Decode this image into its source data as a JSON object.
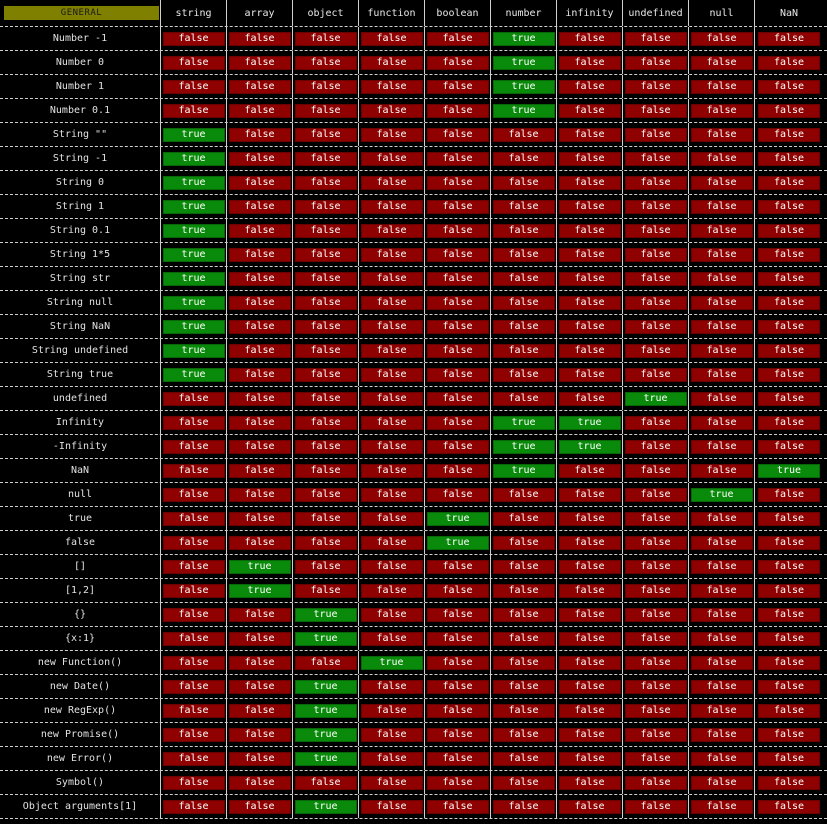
{
  "header": {
    "general_label": "GENERAL",
    "columns": [
      "string",
      "array",
      "object",
      "function",
      "boolean",
      "number",
      "infinity",
      "undefined",
      "null",
      "NaN"
    ]
  },
  "values": {
    "true_label": "true",
    "false_label": "false"
  },
  "colors": {
    "true_bg": "#0a8a0a",
    "false_bg": "#8f0000",
    "general_bg": "#7f7f00",
    "general_text": "#1a1a1a",
    "background": "#000000",
    "divider": "#cfcfcf"
  },
  "rows": [
    {
      "label": "Number -1",
      "values": [
        false,
        false,
        false,
        false,
        false,
        true,
        false,
        false,
        false,
        false
      ]
    },
    {
      "label": "Number 0",
      "values": [
        false,
        false,
        false,
        false,
        false,
        true,
        false,
        false,
        false,
        false
      ]
    },
    {
      "label": "Number 1",
      "values": [
        false,
        false,
        false,
        false,
        false,
        true,
        false,
        false,
        false,
        false
      ]
    },
    {
      "label": "Number 0.1",
      "values": [
        false,
        false,
        false,
        false,
        false,
        true,
        false,
        false,
        false,
        false
      ]
    },
    {
      "label": "String  \"\"",
      "values": [
        true,
        false,
        false,
        false,
        false,
        false,
        false,
        false,
        false,
        false
      ]
    },
    {
      "label": "String -1",
      "values": [
        true,
        false,
        false,
        false,
        false,
        false,
        false,
        false,
        false,
        false
      ]
    },
    {
      "label": "String 0",
      "values": [
        true,
        false,
        false,
        false,
        false,
        false,
        false,
        false,
        false,
        false
      ]
    },
    {
      "label": "String 1",
      "values": [
        true,
        false,
        false,
        false,
        false,
        false,
        false,
        false,
        false,
        false
      ]
    },
    {
      "label": "String 0.1",
      "values": [
        true,
        false,
        false,
        false,
        false,
        false,
        false,
        false,
        false,
        false
      ]
    },
    {
      "label": "String 1*5",
      "values": [
        true,
        false,
        false,
        false,
        false,
        false,
        false,
        false,
        false,
        false
      ]
    },
    {
      "label": "String str",
      "values": [
        true,
        false,
        false,
        false,
        false,
        false,
        false,
        false,
        false,
        false
      ]
    },
    {
      "label": "String null",
      "values": [
        true,
        false,
        false,
        false,
        false,
        false,
        false,
        false,
        false,
        false
      ]
    },
    {
      "label": "String NaN",
      "values": [
        true,
        false,
        false,
        false,
        false,
        false,
        false,
        false,
        false,
        false
      ]
    },
    {
      "label": "String undefined",
      "values": [
        true,
        false,
        false,
        false,
        false,
        false,
        false,
        false,
        false,
        false
      ]
    },
    {
      "label": "String true",
      "values": [
        true,
        false,
        false,
        false,
        false,
        false,
        false,
        false,
        false,
        false
      ]
    },
    {
      "label": "undefined",
      "values": [
        false,
        false,
        false,
        false,
        false,
        false,
        false,
        true,
        false,
        false
      ]
    },
    {
      "label": "Infinity",
      "values": [
        false,
        false,
        false,
        false,
        false,
        true,
        true,
        false,
        false,
        false
      ]
    },
    {
      "label": "-Infinity",
      "values": [
        false,
        false,
        false,
        false,
        false,
        true,
        true,
        false,
        false,
        false
      ]
    },
    {
      "label": "NaN",
      "values": [
        false,
        false,
        false,
        false,
        false,
        true,
        false,
        false,
        false,
        true
      ]
    },
    {
      "label": "null",
      "values": [
        false,
        false,
        false,
        false,
        false,
        false,
        false,
        false,
        true,
        false
      ]
    },
    {
      "label": "true",
      "values": [
        false,
        false,
        false,
        false,
        true,
        false,
        false,
        false,
        false,
        false
      ]
    },
    {
      "label": "false",
      "values": [
        false,
        false,
        false,
        false,
        true,
        false,
        false,
        false,
        false,
        false
      ]
    },
    {
      "label": "[]",
      "values": [
        false,
        true,
        false,
        false,
        false,
        false,
        false,
        false,
        false,
        false
      ]
    },
    {
      "label": "[1,2]",
      "values": [
        false,
        true,
        false,
        false,
        false,
        false,
        false,
        false,
        false,
        false
      ]
    },
    {
      "label": "{}",
      "values": [
        false,
        false,
        true,
        false,
        false,
        false,
        false,
        false,
        false,
        false
      ]
    },
    {
      "label": "{x:1}",
      "values": [
        false,
        false,
        true,
        false,
        false,
        false,
        false,
        false,
        false,
        false
      ]
    },
    {
      "label": "new Function()",
      "values": [
        false,
        false,
        false,
        true,
        false,
        false,
        false,
        false,
        false,
        false
      ]
    },
    {
      "label": "new Date()",
      "values": [
        false,
        false,
        true,
        false,
        false,
        false,
        false,
        false,
        false,
        false
      ]
    },
    {
      "label": "new RegExp()",
      "values": [
        false,
        false,
        true,
        false,
        false,
        false,
        false,
        false,
        false,
        false
      ]
    },
    {
      "label": "new Promise()",
      "values": [
        false,
        false,
        true,
        false,
        false,
        false,
        false,
        false,
        false,
        false
      ]
    },
    {
      "label": "new Error()",
      "values": [
        false,
        false,
        true,
        false,
        false,
        false,
        false,
        false,
        false,
        false
      ]
    },
    {
      "label": "Symbol()",
      "values": [
        false,
        false,
        false,
        false,
        false,
        false,
        false,
        false,
        false,
        false
      ]
    },
    {
      "label": "Object arguments[1]",
      "values": [
        false,
        false,
        true,
        false,
        false,
        false,
        false,
        false,
        false,
        false
      ]
    }
  ]
}
